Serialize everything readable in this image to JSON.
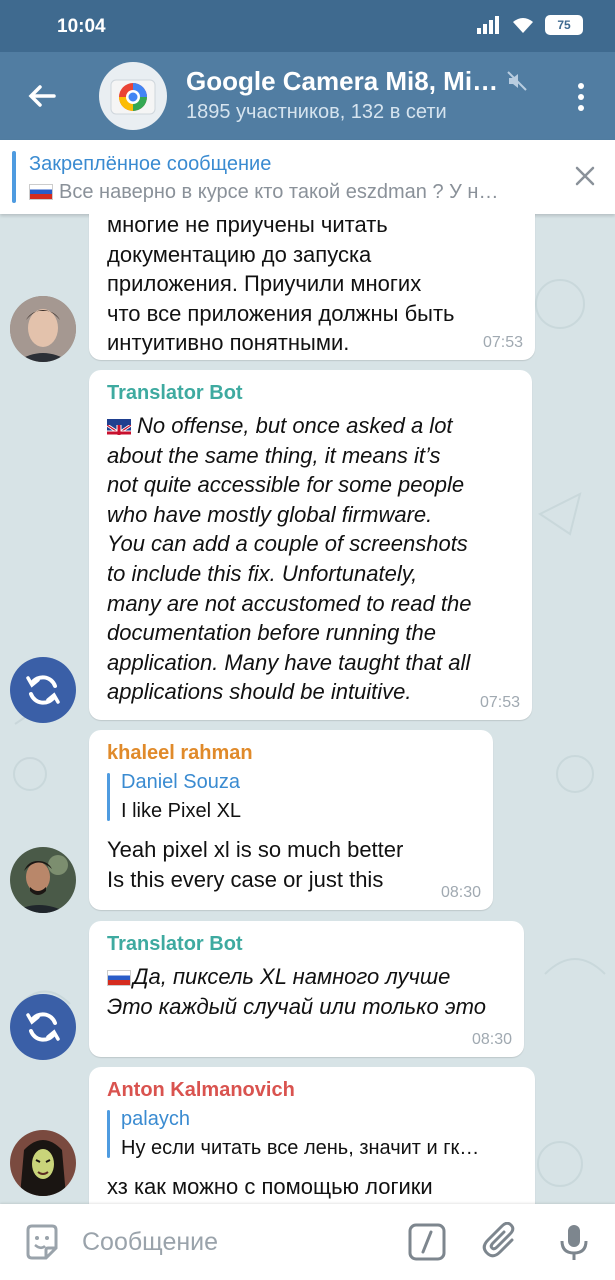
{
  "status": {
    "time": "10:04",
    "battery": "75"
  },
  "header": {
    "title": "Google Camera Mi8, Mi…",
    "subtitle": "1895 участников, 132 в сети"
  },
  "pinned": {
    "label": "Закреплённое сообщение",
    "text": "Все наверно в курсе кто такой eszdman ? У н…"
  },
  "messages": [
    {
      "text": "многие не приучены читать\nдокументацию до запуска\nприложения. Приучили многих\nчто все приложения должны быть\nинтуитивно понятными.",
      "time": "07:53"
    },
    {
      "sender": "Translator Bot",
      "text": "No offense, but once asked a lot\nabout the same thing, it means it’s\nnot quite accessible for some people\nwho have mostly global firmware.\nYou can add a couple of screenshots\nto include this fix. Unfortunately,\nmany are not accustomed to read the\ndocumentation before running the\napplication. Many have taught that all\napplications should be intuitive.",
      "time": "07:53"
    },
    {
      "sender": "khaleel rahman",
      "reply_name": "Daniel Souza",
      "reply_text": "I like Pixel XL",
      "text": "Yeah pixel xl is so much better\nIs this every case or just this",
      "time": "08:30"
    },
    {
      "sender": "Translator Bot",
      "text": "Да, пиксель XL намного лучше\nЭто каждый случай или только это",
      "time": "08:30"
    },
    {
      "sender": "Anton Kalmanovich",
      "reply_name": "palaych",
      "reply_text": "Ну если читать все лень, значит и гк…",
      "text": "хз как можно с помощью логики"
    }
  ],
  "composer": {
    "placeholder": "Сообщение"
  },
  "colors": {
    "header": "#517da2",
    "statusbar": "#3f6a8f",
    "bot_name": "#3eaaa0",
    "khaleel_name": "#e08a2a",
    "anton_name": "#d9534f"
  }
}
